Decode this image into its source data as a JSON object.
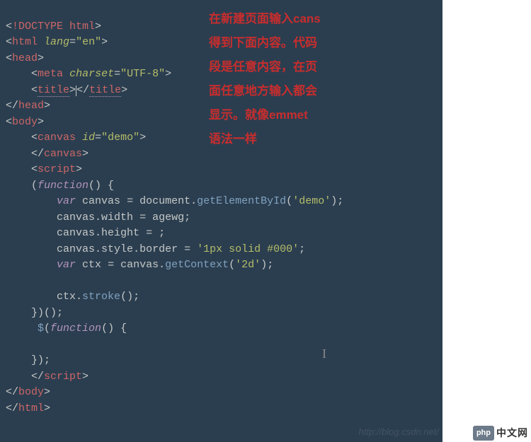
{
  "code": {
    "doctype": "<!DOCTYPE html>",
    "html_open_tag": "html",
    "lang_attr": "lang",
    "lang_val": "\"en\"",
    "head_tag": "head",
    "meta_tag": "meta",
    "charset_attr": "charset",
    "charset_val": "\"UTF-8\"",
    "title_tag": "title",
    "body_tag": "body",
    "canvas_tag": "canvas",
    "id_attr": "id",
    "id_val": "\"demo\"",
    "script_tag": "script",
    "function_kw": "function",
    "var_kw": "var",
    "canvas_var": "canvas",
    "document_var": "document",
    "getById": "getElementById",
    "demo_str": "'demo'",
    "width_prop": "width",
    "agewg": "agewg",
    "height_prop": "height",
    "style_prop": "style",
    "border_prop": "border",
    "border_val": "'1px solid #000'",
    "ctx_var": "ctx",
    "getContext": "getContext",
    "ctx2d_str": "'2d'",
    "stroke": "stroke",
    "jquery": "$"
  },
  "annotation": {
    "line1": "在新建页面输入cans",
    "line2": "得到下面内容。代码",
    "line3": "段是任意内容，在页",
    "line4": "面任意地方输入都会",
    "line5": "显示。就像emmet",
    "line6": "语法一样"
  },
  "watermark": "http://blog.csdn.net/",
  "logo": {
    "badge": "php",
    "text": "中文网"
  }
}
